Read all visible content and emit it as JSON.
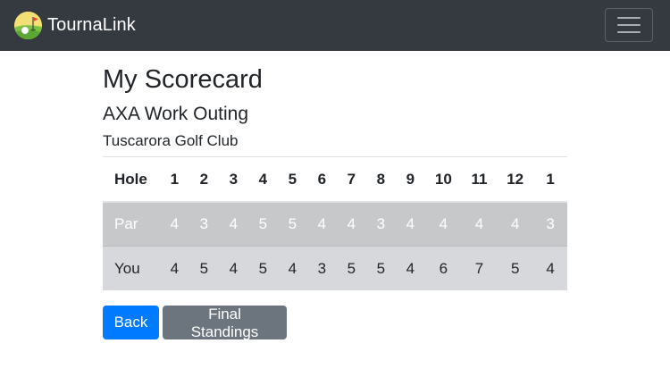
{
  "navbar": {
    "brand": "TournaLink",
    "menu_icon": "hamburger-menu-icon"
  },
  "page": {
    "title": "My Scorecard",
    "event": "AXA Work Outing",
    "course": "Tuscarora Golf Club"
  },
  "scorecard": {
    "header_label": "Hole",
    "holes": [
      "1",
      "2",
      "3",
      "4",
      "5",
      "6",
      "7",
      "8",
      "9",
      "10",
      "11",
      "12",
      "1"
    ],
    "par_label": "Par",
    "par": [
      "4",
      "3",
      "4",
      "5",
      "5",
      "4",
      "4",
      "3",
      "4",
      "4",
      "4",
      "4",
      "3"
    ],
    "you_label": "You",
    "you": [
      "4",
      "5",
      "4",
      "5",
      "4",
      "3",
      "5",
      "5",
      "4",
      "6",
      "7",
      "5",
      "4"
    ]
  },
  "buttons": {
    "back": "Back",
    "final": "Final Standings"
  },
  "colors": {
    "navbar": "#343a40",
    "primary": "#007bff",
    "secondary": "#6c757d",
    "par_row": "#c6c8ca",
    "you_row": "#d6d8db"
  }
}
